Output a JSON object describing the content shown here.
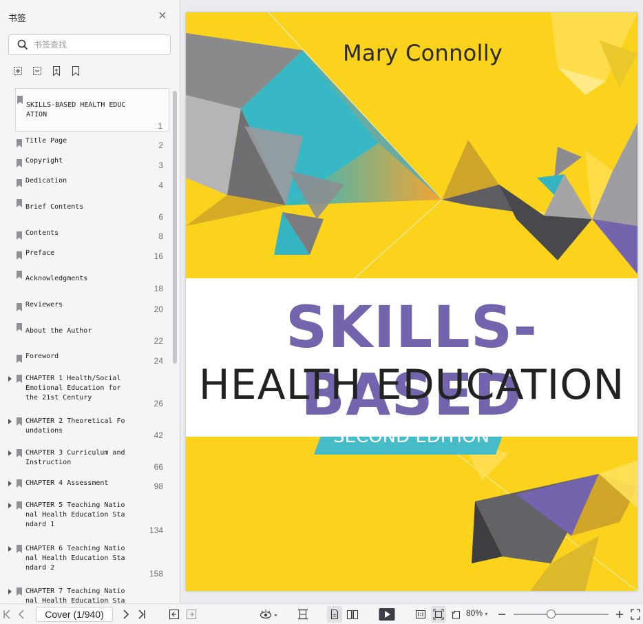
{
  "sidebar": {
    "title": "书签",
    "search_placeholder": "书签查找",
    "bookmarks": [
      {
        "title": "SKILLS-BASED HEALTH EDUC\nATION",
        "page": "1",
        "expandable": false
      },
      {
        "title": "Title Page",
        "page": "2",
        "expandable": false
      },
      {
        "title": "Copyright",
        "page": "3",
        "expandable": false
      },
      {
        "title": "Dedication",
        "page": "4",
        "expandable": false
      },
      {
        "title": "Brief Contents",
        "page": "6",
        "expandable": false
      },
      {
        "title": "Contents",
        "page": "8",
        "expandable": false
      },
      {
        "title": "Preface",
        "page": "16",
        "expandable": false
      },
      {
        "title": "Acknowledgments",
        "page": "18",
        "expandable": false
      },
      {
        "title": "Reviewers",
        "page": "20",
        "expandable": false
      },
      {
        "title": "About the Author",
        "page": "22",
        "expandable": false
      },
      {
        "title": "Foreword",
        "page": "24",
        "expandable": false
      },
      {
        "title": "CHAPTER 1 Health/Social\nEmotional Education for\nthe 21st Century",
        "page": "26",
        "expandable": true
      },
      {
        "title": "CHAPTER 2 Theoretical Fo\nundations",
        "page": "42",
        "expandable": true
      },
      {
        "title": "CHAPTER 3 Curriculum and\nInstruction",
        "page": "66",
        "expandable": true
      },
      {
        "title": "CHAPTER 4 Assessment",
        "page": "98",
        "expandable": true
      },
      {
        "title": "CHAPTER 5 Teaching Natio\nnal Health Education Sta\nndard 1",
        "page": "134",
        "expandable": true
      },
      {
        "title": "CHAPTER 6 Teaching Natio\nnal Health Education Sta\nndard 2",
        "page": "158",
        "expandable": true
      },
      {
        "title": "CHAPTER 7 Teaching Natio\nnal Health Education Sta",
        "page": "",
        "expandable": true
      }
    ]
  },
  "cover": {
    "author": "Mary Connolly",
    "title_line1": "SKILLS-BASED",
    "title_line2": "HEALTH  EDUCATION",
    "edition": "SECOND EDITION"
  },
  "toolbar": {
    "page_indicator": "Cover (1/940)",
    "zoom": "80%"
  },
  "colors": {
    "cover_yellow": "#fbd21c",
    "title_purple": "#7463ad",
    "edition_teal": "#46bcc8"
  }
}
